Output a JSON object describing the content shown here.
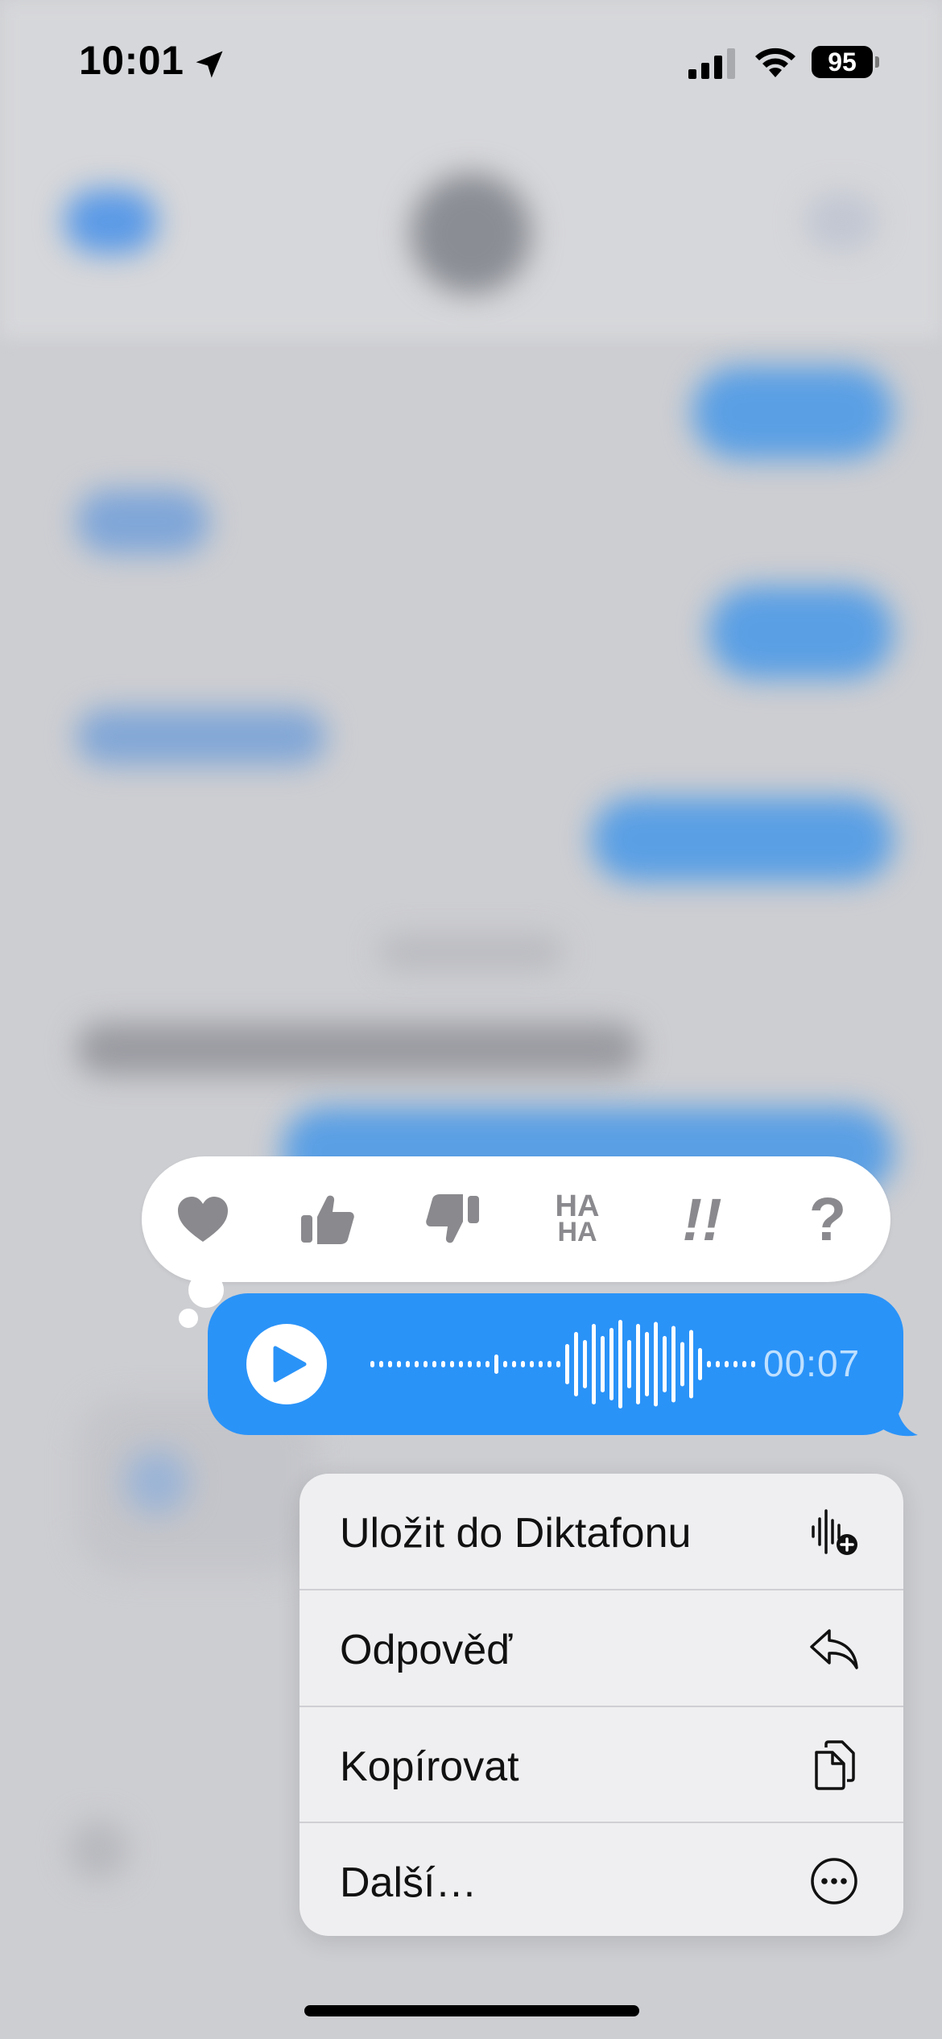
{
  "status_bar": {
    "time": "10:01",
    "battery": "95",
    "location_icon": "location-arrow-icon",
    "signal_icon": "cellular-signal-icon",
    "wifi_icon": "wifi-icon"
  },
  "reactions": [
    {
      "name": "heart-icon",
      "label": "heart"
    },
    {
      "name": "thumbs-up-icon",
      "label": "thumbs up"
    },
    {
      "name": "thumbs-down-icon",
      "label": "thumbs down"
    },
    {
      "name": "haha-icon",
      "text_top": "HA",
      "text_bottom": "HA"
    },
    {
      "name": "exclamation-icon",
      "text": "!!"
    },
    {
      "name": "question-icon",
      "text": "?"
    }
  ],
  "audio_message": {
    "duration": "00:07",
    "bubble_color": "#2a93f8",
    "icon": "play-icon"
  },
  "menu": {
    "items": [
      {
        "label": "Uložit do Diktafonu",
        "icon": "voice-memo-add-icon"
      },
      {
        "label": "Odpověď",
        "icon": "reply-icon"
      },
      {
        "label": "Kopírovat",
        "icon": "copy-icon"
      },
      {
        "label": "Další…",
        "icon": "more-icon"
      }
    ]
  },
  "colors": {
    "accent_blue": "#2a93f8",
    "reaction_gray": "#8a8a8e"
  }
}
